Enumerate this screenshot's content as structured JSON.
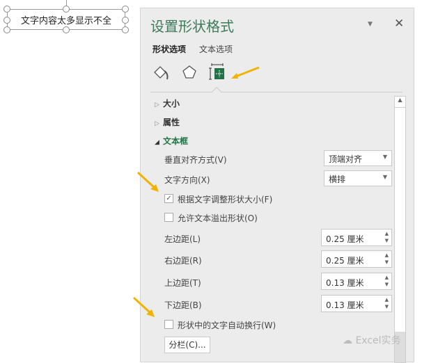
{
  "shape": {
    "text": "文字内容太多显示不全"
  },
  "panel": {
    "title": "设置形状格式",
    "tabs": [
      {
        "label": "形状选项",
        "active": true
      },
      {
        "label": "文本选项",
        "active": false
      }
    ],
    "icons": [
      "fill-line-icon",
      "effects-icon",
      "size-properties-icon"
    ],
    "sections": {
      "size": "大小",
      "properties": "属性",
      "textbox": "文本框"
    },
    "vertical_align": {
      "label": "垂直对齐方式(V)",
      "value": "顶端对齐"
    },
    "text_direction": {
      "label": "文字方向(X)",
      "value": "横排"
    },
    "autofit": {
      "label": "根据文字调整形状大小(F)",
      "checked": true
    },
    "overflow": {
      "label": "允许文本溢出形状(O)",
      "checked": false
    },
    "margins": [
      {
        "label": "左边距(L)",
        "value": "0.25 厘米"
      },
      {
        "label": "右边距(R)",
        "value": "0.25 厘米"
      },
      {
        "label": "上边距(T)",
        "value": "0.13 厘米"
      },
      {
        "label": "下边距(B)",
        "value": "0.13 厘米"
      }
    ],
    "wrap": {
      "label": "形状中的文字自动换行(W)",
      "checked": false
    },
    "columns_button": "分栏(C)..."
  },
  "watermark": "Excel实务",
  "colors": {
    "accent": "#217346",
    "arrow": "#f0b400"
  }
}
